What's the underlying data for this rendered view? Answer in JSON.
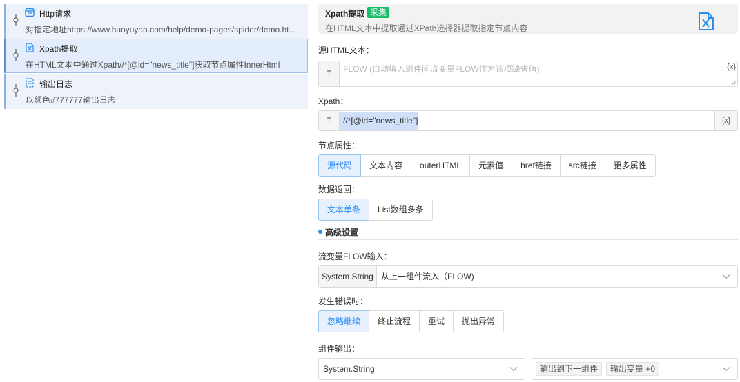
{
  "steps": [
    {
      "title": "Http请求",
      "desc": "对指定地址https://www.huoyuyan.com/help/demo-pages/spider/demo.ht..."
    },
    {
      "title": "Xpath提取",
      "desc": "在HTML文本中通过Xpath//*[@id=\"news_title\"]获取节点属性InnerHtml"
    },
    {
      "title": "输出日志",
      "desc": "以颜色#777777输出日志"
    }
  ],
  "header": {
    "title": "Xpath提取",
    "tag": "采集",
    "desc": "在HTML文本中提取通过XPath选择器提取指定节点内容"
  },
  "source_html": {
    "label": "源HTML文本：",
    "prefix": "T",
    "placeholder": "FLOW (自动填入组件间流变量FLOW作为该项缺省值)",
    "var_button": "{x}"
  },
  "xpath": {
    "label": "Xpath：",
    "prefix": "T",
    "value": "//*[@id=\"news_title\"]",
    "var_button": "{x}"
  },
  "node_attr": {
    "label": "节点属性：",
    "options": [
      "源代码",
      "文本内容",
      "outerHTML",
      "元素值",
      "href链接",
      "src链接",
      "更多属性"
    ],
    "selected": "源代码"
  },
  "data_return": {
    "label": "数据返回：",
    "options": [
      "文本单条",
      "List数组多条"
    ],
    "selected": "文本单条"
  },
  "advanced": {
    "title": "高级设置"
  },
  "flow_input": {
    "label": "流变量FLOW输入：",
    "type": "System.String",
    "value": "从上一组件流入（FLOW)"
  },
  "on_error": {
    "label": "发生错误时：",
    "options": [
      "忽略继续",
      "终止流程",
      "重试",
      "抛出异常"
    ],
    "selected": "忽略继续"
  },
  "output": {
    "label": "组件输出：",
    "type": "System.String",
    "chip_next": "输出到下一组件",
    "chip_var": "输出变量 +0"
  },
  "colors": {
    "accent": "#2d8cf0",
    "tag_green": "#19be6b",
    "step_bg": "#eef3fb"
  },
  "icons": [
    "pin-icon",
    "http-icon",
    "xpath-icon",
    "log-icon",
    "xpath-file-icon",
    "chevron-down-icon"
  ]
}
